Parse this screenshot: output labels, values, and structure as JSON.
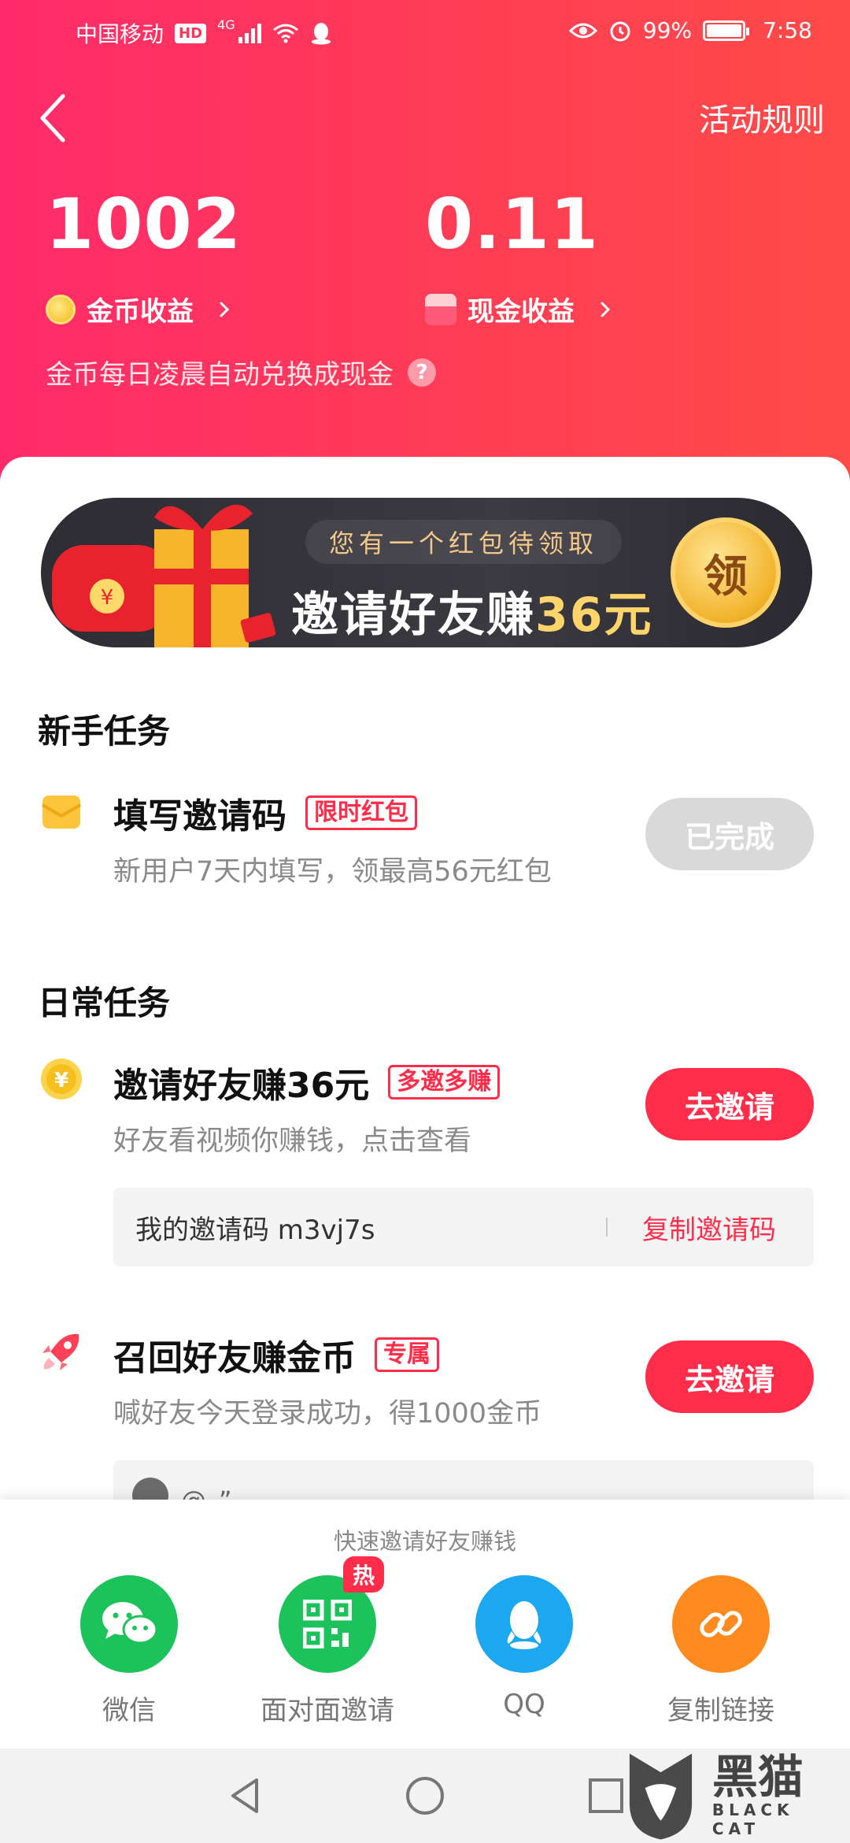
{
  "status_bar": {
    "carrier": "中国移动",
    "hd": "HD",
    "network": "4G",
    "battery": "99%",
    "battery_fraction": 0.99,
    "time": "7:58"
  },
  "header": {
    "rules_label": "活动规则",
    "coins_value": "1002",
    "coins_label": "金币收益",
    "cash_value": "0.11",
    "cash_label": "现金收益",
    "hint": "金币每日凌晨自动兑换成现金",
    "help_glyph": "?"
  },
  "banner": {
    "pill_text": "您有一个红包待领取",
    "title": "邀请好友赚",
    "amount": "36元",
    "claim_label": "领"
  },
  "newbie": {
    "section_title": "新手任务",
    "task": {
      "icon": "envelope-icon",
      "title": "填写邀请码",
      "tag": "限时红包",
      "desc": "新用户7天内填写，领最高56元红包",
      "button": "已完成"
    }
  },
  "daily": {
    "section_title": "日常任务",
    "invite_task": {
      "icon": "yuan-coin-icon",
      "title": "邀请好友赚36元",
      "tag": "多邀多赚",
      "desc": "好友看视频你赚钱，点击查看",
      "button": "去邀请",
      "code_text": "我的邀请码 m3vj7s",
      "copy_label": "复制邀请码"
    },
    "recall_task": {
      "icon": "rocket-icon",
      "title": "召回好友赚金币",
      "tag": "专属",
      "desc": "喊好友今天登录成功，得1000金币",
      "button": "去邀请",
      "comment": "@、”"
    }
  },
  "share": {
    "title": "快速邀请好友赚钱",
    "items": [
      {
        "label": "微信",
        "icon": "wechat-icon",
        "color": "#1bc35a"
      },
      {
        "label": "面对面邀请",
        "icon": "qrcode-icon",
        "color": "#1bc35a",
        "badge": "热"
      },
      {
        "label": "QQ",
        "icon": "qq-icon",
        "color": "#1ba8f0"
      },
      {
        "label": "复制链接",
        "icon": "link-icon",
        "color": "#ff8a1f"
      }
    ]
  },
  "watermark": {
    "big": "黑猫",
    "small": "BLACK CAT"
  },
  "colors": {
    "accent_red": "#ff2d4a",
    "header_gradient_start": "#ff2b6a",
    "header_gradient_end": "#ff4b48",
    "done_gray": "#d9d9d9"
  }
}
